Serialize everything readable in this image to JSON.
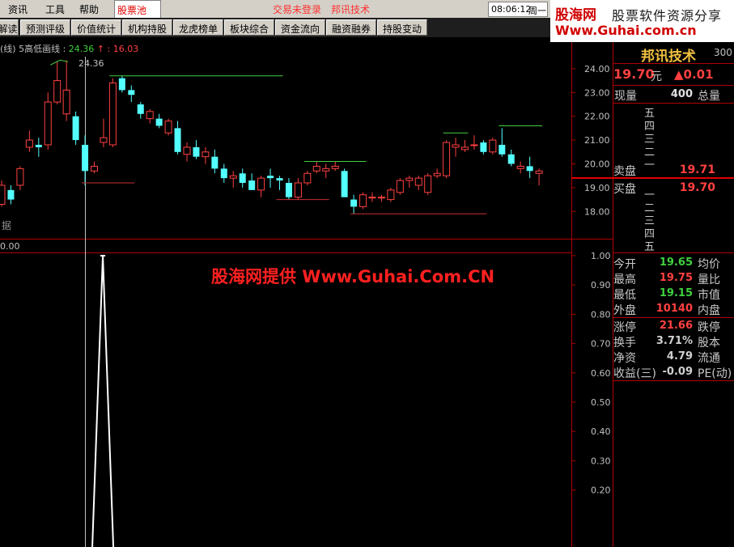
{
  "menu": {
    "items": [
      "资讯",
      "工具",
      "帮助"
    ],
    "active_tab": "股票池",
    "notice1": "交易未登录",
    "notice2": "邦讯技术",
    "time": "08:06:12",
    "weekday": "周一"
  },
  "logo": {
    "brand": "股海网",
    "slogan": "股票软件资源分享",
    "url": "Www.Guhai.com.cn"
  },
  "toolbar": {
    "buttons": [
      "解读",
      "预测评级",
      "价值统计",
      "机构持股",
      "龙虎榜单",
      "板块综合",
      "资金流向",
      "融资融券",
      "持股变动"
    ]
  },
  "main_chart": {
    "title_prefix": "(线) 5高低画线 :",
    "value_green": "24.36",
    "arrow": "↑",
    "value_red": ": 16.03",
    "peak_label": "24.36",
    "corner_label": "据",
    "y_ticks": [
      "24.00",
      "23.00",
      "22.00",
      "21.00",
      "20.00",
      "19.00",
      "18.00"
    ]
  },
  "chart_data": {
    "type": "candlestick",
    "title": "5高低画线",
    "ylim": [
      17.5,
      24.8
    ],
    "candles": [
      {
        "o": 18.3,
        "h": 19.3,
        "l": 18.2,
        "c": 19.1
      },
      {
        "o": 18.9,
        "h": 19.1,
        "l": 18.3,
        "c": 18.5
      },
      {
        "o": 19.1,
        "h": 19.9,
        "l": 18.9,
        "c": 19.8
      },
      {
        "o": 20.7,
        "h": 21.4,
        "l": 20.5,
        "c": 21.0
      },
      {
        "o": 20.8,
        "h": 21.1,
        "l": 20.3,
        "c": 20.7
      },
      {
        "o": 20.8,
        "h": 23.0,
        "l": 20.6,
        "c": 22.6
      },
      {
        "o": 22.6,
        "h": 24.3,
        "l": 22.5,
        "c": 23.5
      },
      {
        "o": 22.1,
        "h": 24.36,
        "l": 21.8,
        "c": 23.1
      },
      {
        "o": 22.0,
        "h": 22.2,
        "l": 20.8,
        "c": 21.0
      },
      {
        "o": 20.8,
        "h": 21.2,
        "l": 19.1,
        "c": 19.7
      },
      {
        "o": 19.7,
        "h": 20.1,
        "l": 19.6,
        "c": 19.9
      },
      {
        "o": 20.9,
        "h": 21.9,
        "l": 20.7,
        "c": 21.1
      },
      {
        "o": 20.8,
        "h": 23.6,
        "l": 20.7,
        "c": 23.4
      },
      {
        "o": 23.6,
        "h": 23.7,
        "l": 23.0,
        "c": 23.1
      },
      {
        "o": 23.1,
        "h": 23.3,
        "l": 22.6,
        "c": 22.9
      },
      {
        "o": 22.5,
        "h": 22.6,
        "l": 21.9,
        "c": 22.1
      },
      {
        "o": 21.9,
        "h": 22.3,
        "l": 21.7,
        "c": 22.2
      },
      {
        "o": 21.9,
        "h": 22.1,
        "l": 21.5,
        "c": 21.6
      },
      {
        "o": 21.3,
        "h": 21.9,
        "l": 21.2,
        "c": 21.8
      },
      {
        "o": 21.5,
        "h": 21.8,
        "l": 20.4,
        "c": 20.5
      },
      {
        "o": 20.4,
        "h": 20.9,
        "l": 20.1,
        "c": 20.7
      },
      {
        "o": 20.7,
        "h": 21.0,
        "l": 20.2,
        "c": 20.3
      },
      {
        "o": 20.3,
        "h": 20.7,
        "l": 20.0,
        "c": 20.5
      },
      {
        "o": 20.3,
        "h": 20.6,
        "l": 19.6,
        "c": 19.8
      },
      {
        "o": 19.8,
        "h": 20.0,
        "l": 19.2,
        "c": 19.4
      },
      {
        "o": 19.4,
        "h": 19.7,
        "l": 19.0,
        "c": 19.5
      },
      {
        "o": 19.6,
        "h": 19.8,
        "l": 19.0,
        "c": 19.2
      },
      {
        "o": 19.3,
        "h": 19.6,
        "l": 18.9,
        "c": 18.9
      },
      {
        "o": 18.9,
        "h": 19.5,
        "l": 18.6,
        "c": 19.4
      },
      {
        "o": 19.5,
        "h": 19.8,
        "l": 19.0,
        "c": 19.4
      },
      {
        "o": 19.4,
        "h": 19.5,
        "l": 18.9,
        "c": 19.3
      },
      {
        "o": 19.2,
        "h": 19.4,
        "l": 18.5,
        "c": 18.6
      },
      {
        "o": 18.6,
        "h": 19.4,
        "l": 18.5,
        "c": 19.2
      },
      {
        "o": 19.2,
        "h": 19.7,
        "l": 19.1,
        "c": 19.6
      },
      {
        "o": 19.7,
        "h": 20.1,
        "l": 19.6,
        "c": 19.9
      },
      {
        "o": 19.7,
        "h": 20.0,
        "l": 19.4,
        "c": 19.8
      },
      {
        "o": 19.8,
        "h": 20.1,
        "l": 19.7,
        "c": 19.9
      },
      {
        "o": 19.7,
        "h": 19.8,
        "l": 18.6,
        "c": 18.6
      },
      {
        "o": 18.5,
        "h": 18.7,
        "l": 17.9,
        "c": 18.2
      },
      {
        "o": 18.2,
        "h": 18.8,
        "l": 18.1,
        "c": 18.7
      },
      {
        "o": 18.6,
        "h": 18.8,
        "l": 18.4,
        "c": 18.6
      },
      {
        "o": 18.6,
        "h": 18.7,
        "l": 18.4,
        "c": 18.6
      },
      {
        "o": 18.5,
        "h": 19.0,
        "l": 18.4,
        "c": 18.9
      },
      {
        "o": 18.8,
        "h": 19.4,
        "l": 18.7,
        "c": 19.3
      },
      {
        "o": 19.3,
        "h": 19.5,
        "l": 19.0,
        "c": 19.4
      },
      {
        "o": 19.1,
        "h": 19.5,
        "l": 18.9,
        "c": 19.4
      },
      {
        "o": 18.8,
        "h": 19.6,
        "l": 18.7,
        "c": 19.5
      },
      {
        "o": 19.5,
        "h": 19.8,
        "l": 19.4,
        "c": 19.6
      },
      {
        "o": 19.5,
        "h": 21.0,
        "l": 19.4,
        "c": 20.9
      },
      {
        "o": 20.7,
        "h": 21.1,
        "l": 20.3,
        "c": 20.8
      },
      {
        "o": 20.6,
        "h": 21.0,
        "l": 20.5,
        "c": 20.7
      },
      {
        "o": 20.8,
        "h": 21.2,
        "l": 20.6,
        "c": 20.8
      },
      {
        "o": 20.9,
        "h": 21.0,
        "l": 20.4,
        "c": 20.5
      },
      {
        "o": 20.5,
        "h": 21.1,
        "l": 20.4,
        "c": 21.0
      },
      {
        "o": 20.8,
        "h": 21.5,
        "l": 20.3,
        "c": 20.4
      },
      {
        "o": 20.4,
        "h": 20.6,
        "l": 19.9,
        "c": 20.0
      },
      {
        "o": 19.8,
        "h": 20.1,
        "l": 19.6,
        "c": 19.9
      },
      {
        "o": 19.9,
        "h": 20.3,
        "l": 19.4,
        "c": 19.7
      },
      {
        "o": 19.6,
        "h": 19.8,
        "l": 19.1,
        "c": 19.7
      }
    ],
    "high_lines": [
      {
        "price": 24.36,
        "from": 7,
        "to": 7
      },
      {
        "price": 23.7,
        "from": 12,
        "to": 30
      },
      {
        "price": 20.1,
        "from": 33,
        "to": 39
      },
      {
        "price": 21.3,
        "from": 48,
        "to": 50
      },
      {
        "price": 21.6,
        "from": 54,
        "to": 58
      }
    ],
    "low_lines": [
      {
        "price": 19.2,
        "from": 9,
        "to": 14
      },
      {
        "price": 18.5,
        "from": 30,
        "to": 35
      },
      {
        "price": 17.9,
        "from": 38,
        "to": 52
      }
    ],
    "indicator": {
      "ylim": [
        0,
        1.0
      ],
      "y_ticks": [
        "1.00",
        "0.90",
        "0.80",
        "0.70",
        "0.60",
        "0.50",
        "0.40",
        "0.30",
        "0.20"
      ],
      "spike_index": 9,
      "spike_value": 1.0
    }
  },
  "sub_chart": {
    "title": "0.00",
    "watermark": "股海网提供 Www.Guhai.Com.CN"
  },
  "quote": {
    "stock_name": "邦讯技术",
    "code": "300",
    "price": "19.70",
    "unit": "元",
    "change": "▲0.01",
    "cur_vol_label": "现量",
    "cur_vol": "400",
    "total_vol_label": "总量",
    "asks": [
      "五",
      "四",
      "三",
      "二",
      "一"
    ],
    "ask_label": "卖盘",
    "ask_price": "19.71",
    "bid_label": "买盘",
    "bid_price": "19.70",
    "bids": [
      "一",
      "二",
      "三",
      "四",
      "五"
    ],
    "stats": [
      {
        "l": "今开",
        "v": "19.65",
        "c": "#40d040",
        "r": "均价"
      },
      {
        "l": "最高",
        "v": "19.75",
        "c": "#ff4040",
        "r": "量比"
      },
      {
        "l": "最低",
        "v": "19.15",
        "c": "#40d040",
        "r": "市值"
      },
      {
        "l": "外盘",
        "v": "10140",
        "c": "#ff4040",
        "r": "内盘"
      }
    ],
    "stats2": [
      {
        "l": "涨停",
        "v": "21.66",
        "c": "#ff4040",
        "r": "跌停"
      },
      {
        "l": "换手",
        "v": "3.71%",
        "c": "#d0d0d0",
        "r": "股本"
      },
      {
        "l": "净资",
        "v": "4.79",
        "c": "#d0d0d0",
        "r": "流通"
      },
      {
        "l": "收益(三)",
        "v": "-0.09",
        "c": "#d0d0d0",
        "r": "PE(动)"
      }
    ]
  },
  "colors": {
    "up": "#ff4040",
    "down": "#54ffff",
    "high_line": "#40d040",
    "low_line": "#c83030",
    "frame": "#b00000"
  }
}
